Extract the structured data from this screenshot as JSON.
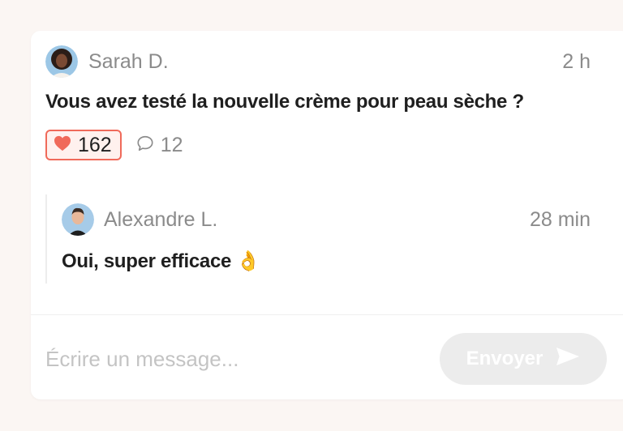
{
  "post": {
    "author": "Sarah D.",
    "time": "2 h",
    "text": "Vous avez testé la nouvelle crème pour peau sèche ?",
    "likes": "162",
    "comments": "12"
  },
  "reply": {
    "author": "Alexandre L.",
    "time": "28 min",
    "text": "Oui, super efficace 👌"
  },
  "composer": {
    "placeholder": "Écrire un message...",
    "send_label": "Envoyer"
  },
  "colors": {
    "accent": "#f06a5a",
    "like_bg": "#fff1ee",
    "muted_text": "#8b8b8b",
    "send_disabled": "#ececec"
  },
  "icons": [
    "heart-icon",
    "comment-icon",
    "send-icon"
  ]
}
